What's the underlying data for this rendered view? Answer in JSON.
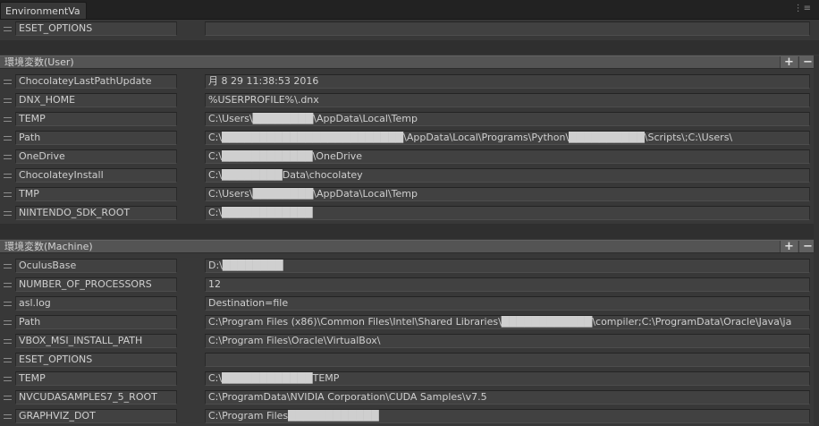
{
  "window": {
    "tab_title": "EnvironmentVa",
    "menu_icon": "kebab-menu-icon"
  },
  "top": {
    "rows": [
      {
        "name": "ESET_OPTIONS",
        "value": ""
      }
    ]
  },
  "user": {
    "title": "環境変数(User)",
    "add_label": "+",
    "remove_label": "−",
    "rows": [
      {
        "name": "ChocolateyLastPathUpdate",
        "value": "月 8 29 11:38:53 2016"
      },
      {
        "name": "DNX_HOME",
        "value": "%USERPROFILE%\\.dnx"
      },
      {
        "name": "TEMP",
        "value": "C:\\Users\\████████\\AppData\\Local\\Temp"
      },
      {
        "name": "Path",
        "value": "C:\\████████████████████████\\AppData\\Local\\Programs\\Python\\██████████\\Scripts\\;C:\\Users\\"
      },
      {
        "name": "OneDrive",
        "value": "C:\\████████████\\OneDrive"
      },
      {
        "name": "ChocolateyInstall",
        "value": "C:\\████████Data\\chocolatey"
      },
      {
        "name": "TMP",
        "value": "C:\\Users\\████████\\AppData\\Local\\Temp"
      },
      {
        "name": "NINTENDO_SDK_ROOT",
        "value": "C:\\████████████"
      }
    ]
  },
  "machine": {
    "title": "環境変数(Machine)",
    "add_label": "+",
    "remove_label": "−",
    "rows": [
      {
        "name": "OculusBase",
        "value": "D:\\████████"
      },
      {
        "name": "NUMBER_OF_PROCESSORS",
        "value": "12"
      },
      {
        "name": "asl.log",
        "value": "Destination=file"
      },
      {
        "name": "Path",
        "value": "C:\\Program Files (x86)\\Common Files\\Intel\\Shared Libraries\\████████████\\compiler;C:\\ProgramData\\Oracle\\Java\\ja"
      },
      {
        "name": "VBOX_MSI_INSTALL_PATH",
        "value": "C:\\Program Files\\Oracle\\VirtualBox\\"
      },
      {
        "name": "ESET_OPTIONS",
        "value": ""
      },
      {
        "name": "TEMP",
        "value": "C:\\████████████TEMP"
      },
      {
        "name": "NVCUDASAMPLES7_5_ROOT",
        "value": "C:\\ProgramData\\NVIDIA Corporation\\CUDA Samples\\v7.5"
      },
      {
        "name": "GRAPHVIZ_DOT",
        "value": "C:\\Program Files████████████"
      }
    ]
  }
}
